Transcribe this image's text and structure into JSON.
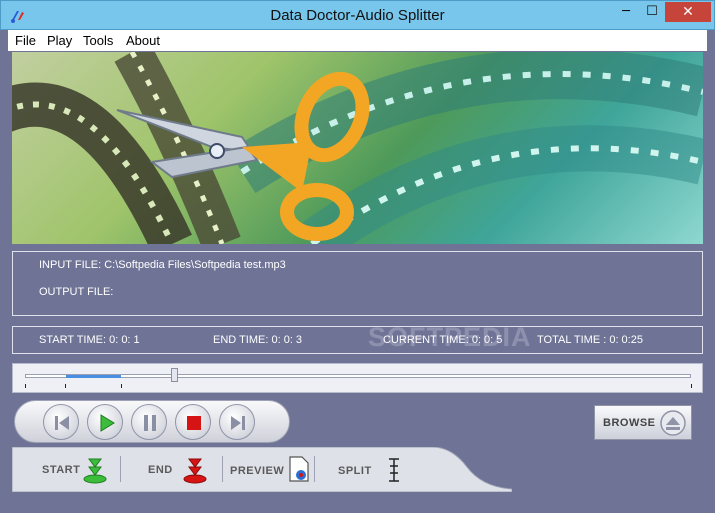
{
  "window": {
    "title": "Data Doctor-Audio Splitter",
    "minimize": "─",
    "maximize": "☐",
    "close": "✕"
  },
  "menu": [
    "File",
    "Play",
    "Tools",
    "About"
  ],
  "banner": {
    "icon": "scissors-film-image"
  },
  "file_info": {
    "input_label": "INPUT FILE: C:\\Softpedia Files\\Softpedia test.mp3",
    "output_label": "OUTPUT FILE:"
  },
  "times": {
    "start": "START TIME:  0: 0: 1",
    "end": "END TIME: 0: 0: 3",
    "current": "CURRENT TIME: 0: 0: 5",
    "total": "TOTAL TIME : 0: 0:25"
  },
  "watermark": "SOFTPEDIA",
  "playback": {
    "buttons": [
      "rewind-icon",
      "play-icon",
      "pause-icon",
      "stop-icon",
      "forward-icon"
    ]
  },
  "browse_label": "BROWSE",
  "actions": {
    "start": "START",
    "end": "END",
    "preview": "PREVIEW",
    "split": "SPLIT"
  },
  "colors": {
    "background": "#6f7396",
    "titlebar": "#78c6ec",
    "close": "#c7443a",
    "play": "#3bbd3b",
    "stop": "#d61414"
  }
}
